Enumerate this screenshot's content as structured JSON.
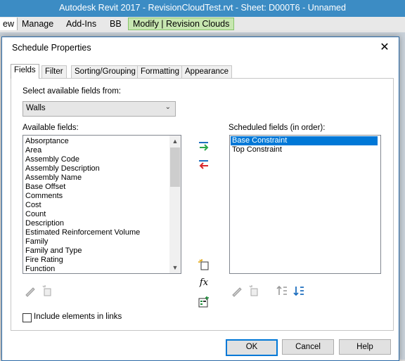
{
  "app": {
    "title": "Autodesk Revit 2017 -      RevisionCloudTest.rvt - Sheet: D000T6 - Unnamed",
    "ribbon_tabs": [
      "ew",
      "Manage",
      "Add-Ins",
      "BB",
      "Modify | Revision Clouds"
    ]
  },
  "dialog": {
    "title": "Schedule Properties",
    "close": "✕",
    "tabs": [
      "Fields",
      "Filter",
      "Sorting/Grouping",
      "Formatting",
      "Appearance"
    ],
    "select_from_label": "Select available fields from:",
    "select_from_value": "Walls",
    "available_label": "Available fields:",
    "available_fields": [
      "Absorptance",
      "Area",
      "Assembly Code",
      "Assembly Description",
      "Assembly Name",
      "Base Offset",
      "Comments",
      "Cost",
      "Count",
      "Description",
      "Estimated Reinforcement Volume",
      "Family",
      "Family and Type",
      "Fire Rating",
      "Function"
    ],
    "scheduled_label": "Scheduled fields (in order):",
    "scheduled_fields": [
      "Base Constraint",
      "Top Constraint"
    ],
    "include_links_label": "Include elements in links",
    "buttons": {
      "ok": "OK",
      "cancel": "Cancel",
      "help": "Help"
    }
  }
}
